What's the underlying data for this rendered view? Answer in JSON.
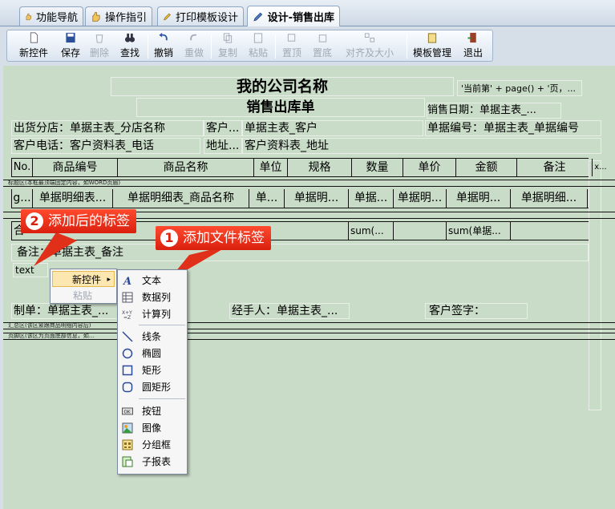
{
  "tabs": [
    {
      "label": "功能导航"
    },
    {
      "label": "操作指引"
    },
    {
      "label": "打印模板设计"
    },
    {
      "label": "设计-销售出库"
    }
  ],
  "toolbar": [
    {
      "label": "新控件",
      "enabled": true,
      "icon": "new-document-icon"
    },
    {
      "label": "保存",
      "enabled": true,
      "icon": "save-disk-icon"
    },
    {
      "label": "删除",
      "enabled": false,
      "icon": "recycle-bin-icon"
    },
    {
      "label": "查找",
      "enabled": true,
      "icon": "binoculars-icon"
    },
    {
      "label": "撤销",
      "enabled": true,
      "icon": "undo-arrow-icon"
    },
    {
      "label": "重做",
      "enabled": false,
      "icon": "redo-arrow-icon"
    },
    {
      "label": "复制",
      "enabled": false,
      "icon": "copy-icon"
    },
    {
      "label": "粘贴",
      "enabled": false,
      "icon": "paste-icon"
    },
    {
      "label": "置顶",
      "enabled": false,
      "icon": "bring-to-front-icon"
    },
    {
      "label": "置底",
      "enabled": false,
      "icon": "send-to-back-icon"
    },
    {
      "label": "对齐及大小",
      "enabled": false,
      "icon": "align-size-icon"
    },
    {
      "label": "模板管理",
      "enabled": true,
      "icon": "template-manage-icon"
    },
    {
      "label": "退出",
      "enabled": true,
      "icon": "exit-door-icon"
    }
  ],
  "report": {
    "company_title": "我的公司名称",
    "page_expr": "'当前第' + page() + '页，...",
    "doc_title": "销售出库单",
    "sale_date": "销售日期：单据主表_...",
    "branch": "出货分店：单据主表_分店名称",
    "customer_label": "客户...",
    "customer_value": "单据主表_客户",
    "doc_no": "单据编号：单据主表_单据编号",
    "phone": "客户电话：客户资料表_电话",
    "address_label": "地址...",
    "address_value": "客户资料表_地址",
    "columns": [
      "No.",
      "商品编号",
      "商品名称",
      "单位",
      "规格",
      "数量",
      "单价",
      "金额",
      "备注",
      "x..."
    ],
    "header_band": "标题区(本框最顶端固定内容，如WORD页眉)",
    "detail_row": [
      "g...",
      "单据明细表...",
      "单据明细表_商品名称",
      "单...",
      "单据明...",
      "单据...",
      "单据明...",
      "单据明...",
      "单据明细..."
    ],
    "total_row": [
      "合",
      "sum(...",
      "sum(单据..."
    ],
    "note": "备注：单据主表_备注",
    "text_control": "text",
    "maker": "制单：单据主表_...",
    "handler": "经手人：单据主表_...",
    "signature": "客户签字：",
    "summary_band": "汇总区(该区紧跟商品明细内容后)",
    "footer_band": "页脚区(该区为页面底部信息，如..."
  },
  "callouts": [
    {
      "num": "2",
      "text": "添加后的标签"
    },
    {
      "num": "1",
      "text": "添加文件标签"
    }
  ],
  "context_menu": {
    "items": [
      {
        "label": "新控件",
        "enabled": true
      },
      {
        "label": "粘贴",
        "enabled": false
      }
    ]
  },
  "submenu": {
    "items": [
      {
        "label": "文本",
        "icon": "text-a-icon"
      },
      {
        "label": "数据列",
        "icon": "data-column-icon"
      },
      {
        "label": "计算列",
        "icon": "calc-column-icon"
      },
      {
        "label": "线条",
        "icon": "line-icon"
      },
      {
        "label": "椭圆",
        "icon": "ellipse-icon"
      },
      {
        "label": "矩形",
        "icon": "rectangle-icon"
      },
      {
        "label": "圆矩形",
        "icon": "round-rectangle-icon"
      },
      {
        "label": "按钮",
        "icon": "button-ok-icon"
      },
      {
        "label": "图像",
        "icon": "image-icon"
      },
      {
        "label": "分组框",
        "icon": "group-box-icon"
      },
      {
        "label": "子报表",
        "icon": "subreport-icon"
      }
    ]
  }
}
